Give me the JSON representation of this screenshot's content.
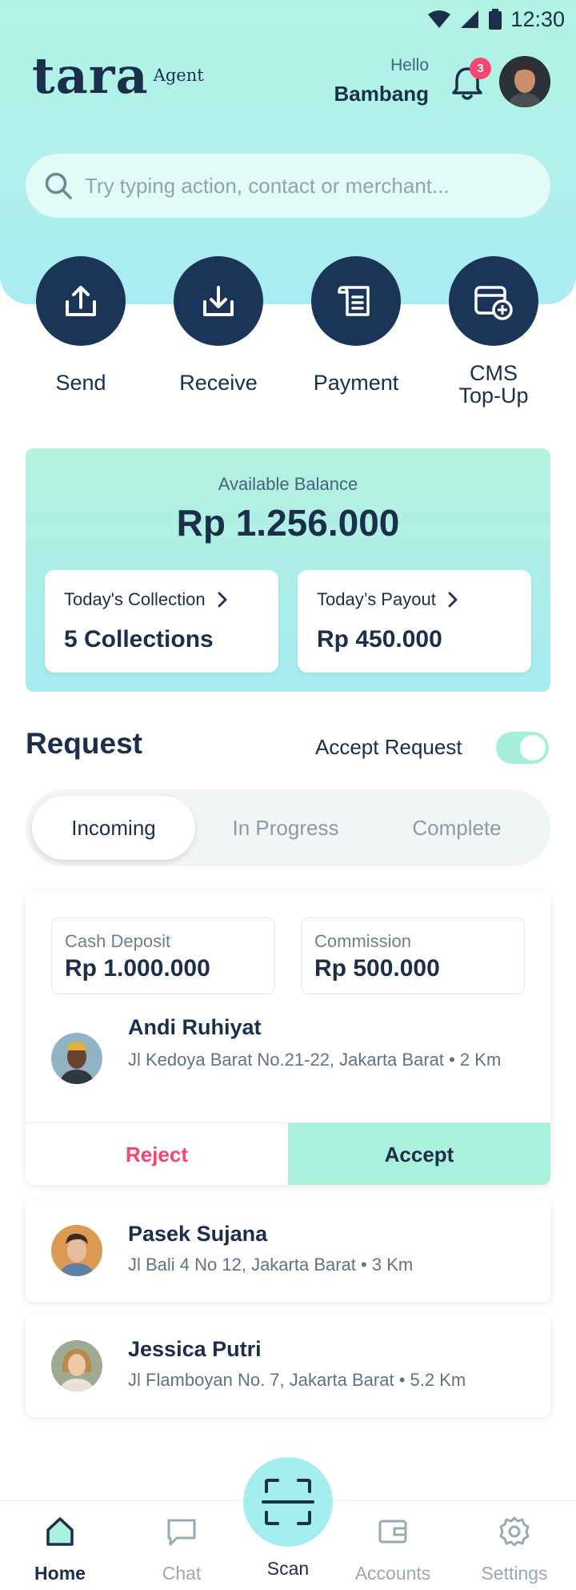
{
  "status_bar": {
    "time": "12:30"
  },
  "header": {
    "brand": "tara",
    "brand_sub": "Agent",
    "greeting": "Hello",
    "user_name": "Bambang",
    "notification_count": "3"
  },
  "search": {
    "placeholder": "Try typing action, contact or merchant..."
  },
  "quick_actions": [
    {
      "label": "Send",
      "icon": "upload-icon"
    },
    {
      "label": "Receive",
      "icon": "download-icon"
    },
    {
      "label": "Payment",
      "icon": "receipt-icon"
    },
    {
      "label": "CMS\nTop-Up",
      "icon": "wallet-add-icon"
    }
  ],
  "balance": {
    "label": "Available Balance",
    "amount": "Rp 1.256.000",
    "collection_title": "Today's Collection",
    "collection_value": "5 Collections",
    "payout_title": "Today’s Payout",
    "payout_value": "Rp 450.000"
  },
  "request": {
    "title": "Request",
    "accept_label": "Accept Request",
    "accept_enabled": true,
    "tabs": [
      "Incoming",
      "In Progress",
      "Complete"
    ],
    "active_tab": "Incoming"
  },
  "requests": [
    {
      "cash_label": "Cash Deposit",
      "cash_value": "Rp 1.000.000",
      "commission_label": "Commission",
      "commission_value": "Rp 500.000",
      "name": "Andi Ruhiyat",
      "address": "Jl Kedoya Barat No.21-22, Jakarta Barat • 2 Km",
      "reject_label": "Reject",
      "accept_label": "Accept"
    },
    {
      "name": "Pasek Sujana",
      "address": "Jl Bali 4 No 12, Jakarta Barat • 3 Km"
    },
    {
      "name": "Jessica Putri",
      "address": "Jl Flamboyan No. 7, Jakarta Barat • 5.2 Km"
    }
  ],
  "bottom_nav": {
    "items": [
      "Home",
      "Chat",
      "Scan",
      "Accounts",
      "Settings"
    ],
    "active": "Home"
  },
  "colors": {
    "primary": "#1b3558",
    "accent": "#aaf0dd",
    "danger": "#f5466f"
  }
}
